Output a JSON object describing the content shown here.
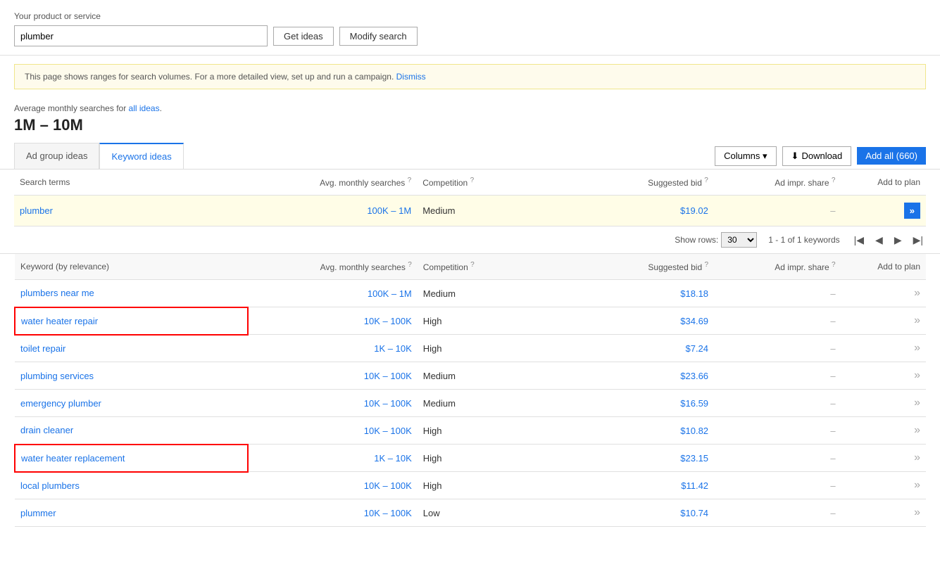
{
  "header": {
    "product_label": "Your product or service",
    "search_value": "plumber",
    "btn_get_ideas": "Get ideas",
    "btn_modify": "Modify search"
  },
  "banner": {
    "text": "This page shows ranges for search volumes. For a more detailed view, set up and run a campaign.",
    "dismiss": "Dismiss"
  },
  "avg": {
    "label": "Average monthly searches for",
    "link": "all ideas",
    "range": "1M – 10M"
  },
  "tabs": [
    {
      "label": "Ad group ideas",
      "active": false
    },
    {
      "label": "Keyword ideas",
      "active": true
    }
  ],
  "toolbar": {
    "columns_btn": "Columns",
    "download_btn": "Download",
    "add_all_btn": "Add all (660)"
  },
  "search_terms_table": {
    "headers": [
      {
        "label": "Search terms",
        "has_help": false
      },
      {
        "label": "Avg. monthly searches",
        "has_help": true
      },
      {
        "label": "Competition",
        "has_help": true
      },
      {
        "label": "Suggested bid",
        "has_help": true
      },
      {
        "label": "Ad impr. share",
        "has_help": true
      },
      {
        "label": "Add to plan",
        "has_help": false
      }
    ],
    "rows": [
      {
        "term": "plumber",
        "avg": "100K – 1M",
        "competition": "Medium",
        "bid": "$19.02",
        "ad_impr": "–",
        "add": "»",
        "highlighted": true,
        "red_border": false
      }
    ]
  },
  "pagination": {
    "show_rows_label": "Show rows:",
    "rows_value": "30",
    "range_text": "1 - 1 of 1 keywords"
  },
  "keyword_table": {
    "headers": [
      {
        "label": "Keyword (by relevance)",
        "has_help": false
      },
      {
        "label": "Avg. monthly searches",
        "has_help": true
      },
      {
        "label": "Competition",
        "has_help": true
      },
      {
        "label": "Suggested bid",
        "has_help": true
      },
      {
        "label": "Ad impr. share",
        "has_help": true
      },
      {
        "label": "Add to plan",
        "has_help": false
      }
    ],
    "rows": [
      {
        "keyword": "plumbers near me",
        "avg": "100K – 1M",
        "competition": "Medium",
        "bid": "$18.18",
        "ad_impr": "–",
        "red_border": false
      },
      {
        "keyword": "water heater repair",
        "avg": "10K – 100K",
        "competition": "High",
        "bid": "$34.69",
        "ad_impr": "–",
        "red_border": true
      },
      {
        "keyword": "toilet repair",
        "avg": "1K – 10K",
        "competition": "High",
        "bid": "$7.24",
        "ad_impr": "–",
        "red_border": false
      },
      {
        "keyword": "plumbing services",
        "avg": "10K – 100K",
        "competition": "Medium",
        "bid": "$23.66",
        "ad_impr": "–",
        "red_border": false
      },
      {
        "keyword": "emergency plumber",
        "avg": "10K – 100K",
        "competition": "Medium",
        "bid": "$16.59",
        "ad_impr": "–",
        "red_border": false
      },
      {
        "keyword": "drain cleaner",
        "avg": "10K – 100K",
        "competition": "High",
        "bid": "$10.82",
        "ad_impr": "–",
        "red_border": false
      },
      {
        "keyword": "water heater replacement",
        "avg": "1K – 10K",
        "competition": "High",
        "bid": "$23.15",
        "ad_impr": "–",
        "red_border": true
      },
      {
        "keyword": "local plumbers",
        "avg": "10K – 100K",
        "competition": "High",
        "bid": "$11.42",
        "ad_impr": "–",
        "red_border": false
      },
      {
        "keyword": "plummer",
        "avg": "10K – 100K",
        "competition": "Low",
        "bid": "$10.74",
        "ad_impr": "–",
        "red_border": false
      }
    ]
  }
}
